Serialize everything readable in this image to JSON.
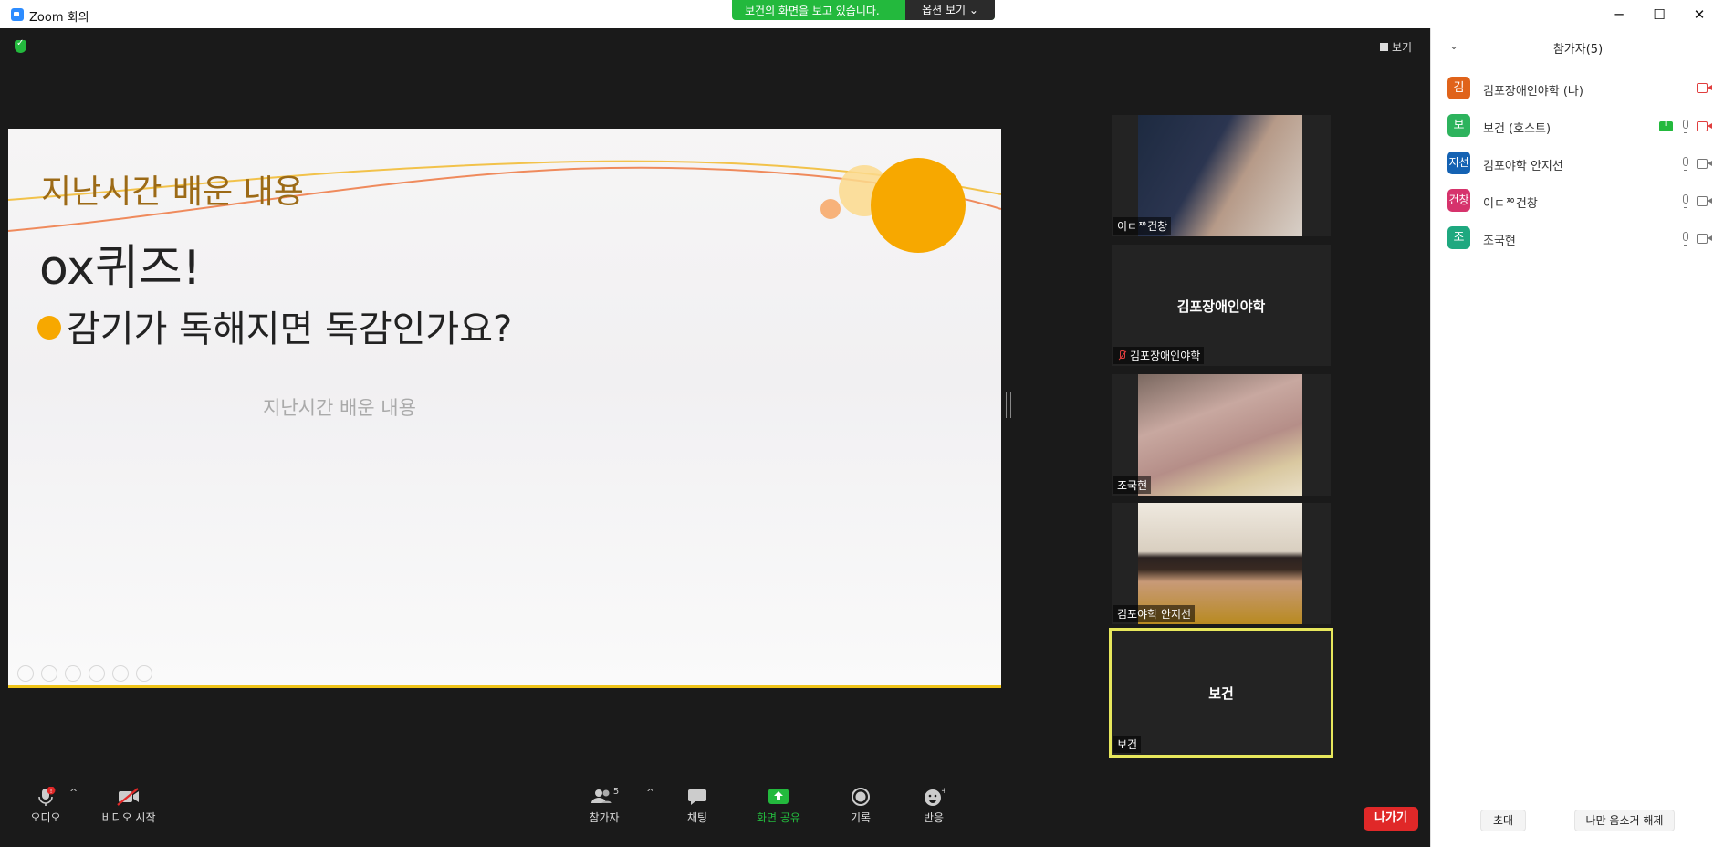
{
  "window": {
    "title": "Zoom 회의"
  },
  "share_banner": {
    "message": "보건의 화면을 보고 있습니다.",
    "options_label": "옵션 보기"
  },
  "view_button": {
    "label": "보기"
  },
  "slide": {
    "title": "지난시간 배운 내용",
    "heading": "ox퀴즈!",
    "bullet": "감기가 독해지면 독감인가요?",
    "footer": "지난시간 배운 내용"
  },
  "tiles": [
    {
      "name": "이ㄷᅍ건창",
      "kind": "video"
    },
    {
      "name": "김포장애인야학",
      "center_name": "김포장애인야학",
      "muted": true
    },
    {
      "name": "조국현",
      "kind": "video"
    },
    {
      "name": "김포야학 안지선",
      "kind": "video"
    },
    {
      "name": "보건",
      "center_name": "보건",
      "active": true
    }
  ],
  "toolbar": {
    "audio": "오디오",
    "video": "비디오 시작",
    "participants": "참가자",
    "participants_count": "5",
    "chat": "채팅",
    "share": "화면 공유",
    "record": "기록",
    "reactions": "반응",
    "leave": "나가기"
  },
  "panel": {
    "title": "참가자(5)",
    "participants": [
      {
        "avatar": "김",
        "color": "#e0631a",
        "name": "김포장애인야학 (나)"
      },
      {
        "avatar": "보",
        "color": "#2db35d",
        "name": "보건 (호스트)"
      },
      {
        "avatar": "지선",
        "color": "#1462b3",
        "name": "김포야학 안지선"
      },
      {
        "avatar": "건창",
        "color": "#d6336c",
        "name": "이ㄷᅍ건창"
      },
      {
        "avatar": "조",
        "color": "#1ea87f",
        "name": "조국현"
      }
    ],
    "invite_label": "초대",
    "unmute_label": "나만 음소거 해제"
  },
  "colors": {
    "share_green": "#23b93d",
    "leave_red": "#e02828",
    "active_speaker": "#e7e75c",
    "slide_accent": "#f7a800"
  }
}
